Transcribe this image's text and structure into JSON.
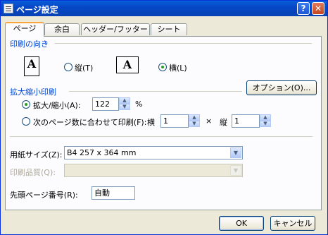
{
  "window": {
    "title": "ページ設定",
    "help_label": "?",
    "close_label": "✕"
  },
  "tabs": [
    {
      "label": "ページ",
      "active": true
    },
    {
      "label": "余白"
    },
    {
      "label": "ヘッダー/フッター"
    },
    {
      "label": "シート"
    }
  ],
  "orientation": {
    "group_label": "印刷の向き",
    "portrait_icon_text": "A",
    "landscape_icon_text": "A",
    "portrait_label": "縦(T)",
    "landscape_label": "横(L)",
    "selected": "landscape"
  },
  "scaling": {
    "group_label": "拡大縮小印刷",
    "zoom_label": "拡大/縮小(A):",
    "zoom_value": "122",
    "percent": "%",
    "fit_label": "次のページ数に合わせて印刷(F):",
    "wide_label": "横",
    "wide_value": "1",
    "times": "×",
    "tall_label": "縦",
    "tall_value": "1",
    "selected": "zoom"
  },
  "options_button": "オプション(O)...",
  "paper": {
    "label": "用紙サイズ(Z):",
    "value": "B4 257 x 364 mm"
  },
  "quality": {
    "label": "印刷品質(Q):",
    "value": ""
  },
  "first_page": {
    "label": "先頭ページ番号(R):",
    "value": "自動"
  },
  "buttons": {
    "ok": "OK",
    "cancel": "キャンセル"
  }
}
